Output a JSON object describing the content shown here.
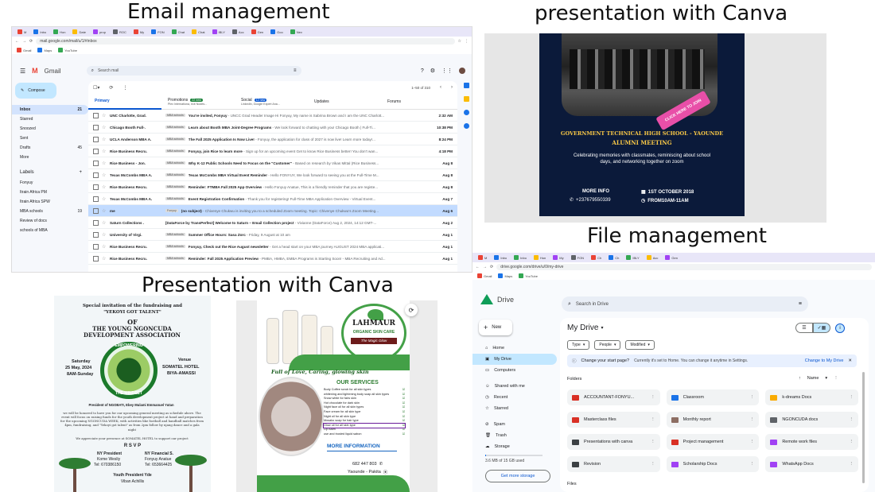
{
  "headings": {
    "email": "Email management",
    "canva_top": "presentation with Canva",
    "files": "File management",
    "canva_bottom": "Presentation with Canva"
  },
  "colors": {
    "gmail_red": "#ea4335",
    "drive_blue": "#1a73e8",
    "canva_navy": "#0b1a3a",
    "compose": "#c2e7ff"
  },
  "gmail": {
    "tabs": [
      "M",
      "Inbo",
      "Hon",
      "Date",
      "prop",
      "ROC",
      "My",
      "FON",
      "Chat",
      "Chat",
      "IBLY",
      "Acc",
      "Gen",
      "Goo",
      "Nev"
    ],
    "url": "mail.google.com/mail/u/1/#inbox",
    "bookmarks": [
      "Gmail",
      "Maps",
      "YouTube"
    ],
    "logo": "Gmail",
    "search_placeholder": "Search mail",
    "compose": "Compose",
    "folders": [
      {
        "name": "Inbox",
        "count": "21"
      },
      {
        "name": "Starred",
        "count": ""
      },
      {
        "name": "Snoozed",
        "count": ""
      },
      {
        "name": "Sent",
        "count": ""
      },
      {
        "name": "Drafts",
        "count": "45"
      },
      {
        "name": "More",
        "count": ""
      }
    ],
    "labels_title": "Labels",
    "labels": [
      {
        "name": "Fonyuy",
        "count": ""
      },
      {
        "name": "Itrain Africa PM",
        "count": ""
      },
      {
        "name": "Itrain Africa SPW",
        "count": ""
      },
      {
        "name": "MBA schools",
        "count": "19"
      },
      {
        "name": "Review of docs",
        "count": ""
      },
      {
        "name": "schools of MBA",
        "count": ""
      }
    ],
    "pagination": "1–50 of 310",
    "inbox_tabs": [
      {
        "name": "Primary",
        "badge": "",
        "sub": ""
      },
      {
        "name": "Promotions",
        "badge": "22 new",
        "sub": "Plex Internationa, ecb Nodes..."
      },
      {
        "name": "Social",
        "badge": "12 new",
        "sub": "LinkedIn, Google Expert Ana..."
      },
      {
        "name": "Updates",
        "badge": "",
        "sub": ""
      },
      {
        "name": "Forums",
        "badge": "",
        "sub": ""
      }
    ],
    "emails": [
      {
        "sender": "UNC Charlotte, Grad.",
        "label": "MBA schools",
        "subject": "You're invited, Fonyuy",
        "snippet": " - UNCC Grad Header Image Hi Fonyuy, My name is Sabrina Brown and I am the UNC Charlott...",
        "date": "2:32 AM"
      },
      {
        "sender": "Chicago Booth Full-.",
        "label": "MBA schools",
        "subject": "Learn about Booth MBA Joint-Degree Programs",
        "snippet": " - We look forward to chatting with you! Chicago Booth | Full-Ti...",
        "date": "10:38 PM"
      },
      {
        "sender": "UCLA Anderson MBA A.",
        "label": "MBA schools",
        "subject": "The Fall 2025 Application Is Now Live!",
        "snippet": " - Fonyuy, the application for class of 2027 is now live! Learn more today!...",
        "date": "8:24 PM"
      },
      {
        "sender": "Rice Business Recru.",
        "label": "MBA schools",
        "subject": "Fonyuy, join Rice to learn more",
        "snippet": " - Sign up for an upcoming event Get to know Rice Business better! You don't wan...",
        "date": "4:18 PM"
      },
      {
        "sender": "Rice Business - Jon.",
        "label": "MBA schools",
        "subject": "Why K-12 Public Schools Need to Focus on the \"Customer\"",
        "snippet": " - Based on research by Vikas Mittal (Rice Business...",
        "date": "Aug 8"
      },
      {
        "sender": "Texas McCombs MBA A.",
        "label": "MBA schools",
        "subject": "Texas McCombs MBA Virtual Event Reminder",
        "snippet": " - Hello FONYUY, We look forward to seeing you at the Full-Time M...",
        "date": "Aug 8"
      },
      {
        "sender": "Rice Business Recru.",
        "label": "MBA schools",
        "subject": "Reminder: FTMBA Fall 2025 App Overview",
        "snippet": " - Hello Fonyuy Anatue, This is a friendly reminder that you are registe...",
        "date": "Aug 8"
      },
      {
        "sender": "Texas McCombs MBA A.",
        "label": "MBA schools",
        "subject": "Event Registration Confirmation",
        "snippet": " - Thank you for registering! Full-Time MBA Application Overview - Virtual Event...",
        "date": "Aug 7"
      },
      {
        "sender": "me",
        "label": "Fonyuy",
        "subject": "(no subject)",
        "snippet": " - Chivenye Chukwu is inviting you to a scheduled Zoom meeting. Topic: Chivenye Chukwu's Zoom Meeting...",
        "date": "Aug 6"
      },
      {
        "sender": "Saturn Collections .",
        "label": "",
        "subject": "[DataForce by TransPerfect] Welcome to Saturn – Email Collection project",
        "snippet": " - Vivianne (DataForce) Aug 2, 2024, 14:12 GMT-...",
        "date": "Aug 2"
      },
      {
        "sender": "University of Virgi.",
        "label": "MBA schools",
        "subject": "Summer Office Hours: Sasa Zorc",
        "snippet": " - Friday, 9 August at 10 am",
        "date": "Aug 1"
      },
      {
        "sender": "Rice Business Recru.",
        "label": "MBA schools",
        "subject": "Fonyuy, Check out the Rice August newsletter",
        "snippet": " - Get a head start on your MBA journey AUGUST 2024 MBA applicati...",
        "date": "Aug 1"
      },
      {
        "sender": "Rice Business Recru.",
        "label": "MBA schools",
        "subject": "Reminder: Fall 2025 Application Preview",
        "snippet": " - PMBA, HMBA, EMBA Programs is Starting Soon! - MBA Recruiting and Ad...",
        "date": "Aug 1"
      }
    ]
  },
  "canva_alumni": {
    "cta": "CLICK HERE TO JOIN",
    "title1": "GOVERNMENT TECHNICAL HIGH SCHOOL - YAOUNDE",
    "title2": "ALUMNI MEETING",
    "body": "Celebrating memories with classmates, reminiscing about school days, and networking together on zoom",
    "more_info": "MORE INFO",
    "phone": "+237679550339",
    "date": "1ST OCTOBER  2018",
    "time": "FROM10AM-11AM"
  },
  "canva_fundraising": {
    "line1": "Special invitation of the fundraising and",
    "line2": "\"YEKOYI GOT TALENT\"",
    "of": "OF",
    "assoc": "THE YOUNG NGONCUDA DEVELOPMENT ASSOCIATION",
    "ring_top": "EMPOWERING",
    "ring_bottom": "THE MINDSET",
    "day": "Saturday",
    "date": "25 May, 2024",
    "time": "8AM-Sunday",
    "venue_label": "Venue",
    "venue": "SOMATEL HOTEL",
    "venue2": "BIYA-AMASSI",
    "president": "President of NGOBATI, Ebey Mulami Emmanuel Yutan",
    "body": "we will be honored to have you for our upcoming general meeting as schedule above. The event will focus on raising funds for the youth development project at hand and preparation for the upcoming NGONCUDA WEEK, with activities like football and handball matches from 4pm, fundraising, and \"Yekoyi got talent\" as from 2pm follow by njang dance and a gala night",
    "appreciation": "We appreciate your presence at SOMATEL HOTEL to support our project",
    "rsvp": "R S V P",
    "p1_title": "NY President",
    "p1_name": "Kome Wesliy",
    "p1_phone": "Tel: 670386150",
    "p2_title": "NY Financial S.",
    "p2_name": "Fonyuy Anatue",
    "p2_phone": "Tel: 653664425",
    "youth": "Youth President Yde",
    "youth_name": "Viban Achillis"
  },
  "canva_skincare": {
    "brand": "LAHMAUR",
    "brand_sub": "ORGANIC SKIN CARE",
    "tagline": "The Magic Glow",
    "slogan": "Full of Love, Caring, glowing skin",
    "services_title": "OUR SERVICES",
    "services": [
      "Body Coffee scrub for all skin types",
      "whitening and lightening body soap all skin types",
      "Snow white for fairs skin",
      "Hot chocolate for dark skin",
      "Night face oil for all skin types",
      "Face cream for all skin type",
      "Night oil for all skin type",
      "Mosako soap for hair type",
      "Glow oil for all skin type",
      "Lip Balm",
      "use and trusted liquid sabon"
    ],
    "more_info": "MORE INFORMATION",
    "phone": "682 447 803",
    "location": "Yaounde - Pakita"
  },
  "drive": {
    "tabs": [
      "M",
      "Inbo",
      "Inbo",
      "Hon",
      "My",
      "FON",
      "Ch",
      "Ch",
      "IBLY",
      "Acc",
      "Gen"
    ],
    "url": "drive.google.com/drive/u/0/my-drive",
    "bookmarks": [
      "Gmail",
      "Maps",
      "YouTube"
    ],
    "logo": "Drive",
    "search_placeholder": "Search in Drive",
    "new_button": "New",
    "nav": [
      "Home",
      "My Drive",
      "Computers",
      "Shared with me",
      "Recent",
      "Starred",
      "Spam",
      "Trash",
      "Storage"
    ],
    "storage_text": "3.6 MB of 15 GB used",
    "storage_button": "Get more storage",
    "title": "My Drive",
    "filters": [
      "Type",
      "People",
      "Modified"
    ],
    "banner_title": "Change your start page?",
    "banner_text": "Currently it's set to Home. You can change it anytime in Settings.",
    "banner_link": "Change to My Drive",
    "folders_label": "Folders",
    "sort_label": "Name",
    "folders": [
      {
        "name": "ACCOUNTANT-FONYU...",
        "color": "#d93025"
      },
      {
        "name": "Classroom",
        "color": "#1a73e8"
      },
      {
        "name": "k-dreams Docs",
        "color": "#f9ab00"
      },
      {
        "name": "Masterclass files",
        "color": "#d93025"
      },
      {
        "name": "Monthly report",
        "color": "#8d6e63"
      },
      {
        "name": "NGONCUDA docs",
        "color": "#5f6368"
      },
      {
        "name": "Presentations with canva",
        "color": "#3c4043"
      },
      {
        "name": "Project management",
        "color": "#d93025"
      },
      {
        "name": "Remote work files",
        "color": "#a142f4"
      },
      {
        "name": "Revision",
        "color": "#3c4043"
      },
      {
        "name": "Scholarship Docs",
        "color": "#a142f4"
      },
      {
        "name": "WhatsApp Docs",
        "color": "#a142f4"
      }
    ],
    "files_label": "Files"
  }
}
